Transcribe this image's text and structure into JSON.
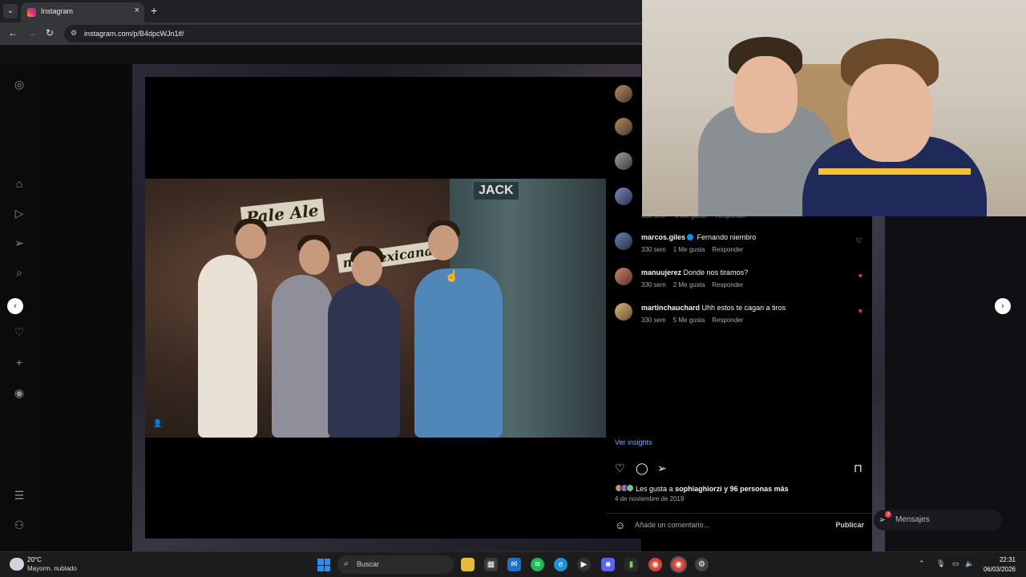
{
  "browser": {
    "tab_title": "Instagram",
    "url": "instagram.com/p/B4dpcWJn1if/",
    "new_tab_label": "+",
    "close_tab_label": "×"
  },
  "comments": [
    {
      "user": "marcos.giles",
      "verified": true,
      "text": "Fernando niembro",
      "time": "330 sem",
      "likes": "1 Me gusta",
      "reply": "Responder",
      "liked": false
    },
    {
      "user": "manuujerez",
      "verified": false,
      "text": "Donde nos tiramos?",
      "time": "330 sem",
      "likes": "2 Me gusta",
      "reply": "Responder",
      "liked": true
    },
    {
      "user": "martinchauchard",
      "verified": false,
      "text": "Uhh estos te cagan a tiros",
      "time": "330 sem",
      "likes": "5 Me gusta",
      "reply": "Responder",
      "liked": true
    }
  ],
  "partial_comment": {
    "time": "330 sem",
    "likes": "3 Me gusta",
    "reply": "Responder"
  },
  "post": {
    "insights_label": "Ver insights",
    "likes_prefix": "Les gusta a",
    "likes_user": "sophiaghiorzi",
    "likes_mid": "y",
    "likes_others": "96 personas más",
    "date": "4 de noviembre de 2019",
    "comment_placeholder": "Añade un comentario...",
    "publish_label": "Publicar",
    "photo_signs": [
      "Pale Ale",
      "na Mexicana",
      "JACK"
    ]
  },
  "messages": {
    "label": "Mensajes",
    "badge": "3"
  },
  "taskbar": {
    "temperature": "20°C",
    "weather": "Mayorm. nublado",
    "search_label": "Buscar",
    "time": "22:31",
    "date": "06/03/2026"
  },
  "colors": {
    "like_red": "#ff3040",
    "link_blue": "#6ea8fe",
    "verified_blue": "#0095f6"
  }
}
